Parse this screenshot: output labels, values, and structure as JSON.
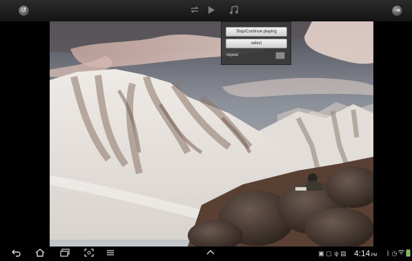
{
  "topbar": {
    "left_icon": "refresh-icon",
    "right_icon": "exit-icon",
    "center_icons": [
      "repeat-icon",
      "play-icon",
      "music-icon"
    ]
  },
  "menu": {
    "stop_continue_label": "Stop/Continue playing",
    "select_label": "select",
    "repeat_label": "repeat",
    "repeat_checked": false
  },
  "scene": {
    "description_icon": "mountain-scene"
  },
  "navbar": {
    "buttons": [
      "back-icon",
      "home-icon",
      "recent-apps-icon",
      "screenshot-icon",
      "menu-icon",
      "up-chevron-icon"
    ],
    "status_icons": [
      "screen-mirror-icon",
      "sd-card-icon",
      "usb-icon",
      "gallery-icon"
    ],
    "clock_time": "4:14",
    "clock_ampm": "PM",
    "right_status_icons": [
      "bluetooth-icon",
      "alarm-icon",
      "wifi-icon",
      "battery-icon"
    ]
  }
}
